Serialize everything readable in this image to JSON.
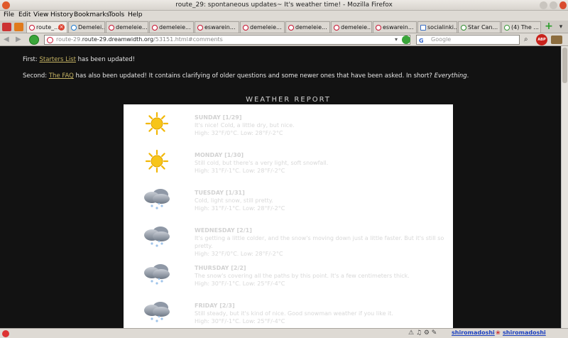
{
  "window": {
    "title": "route_29: spontaneous updates~ It's weather time! - Mozilla Firefox"
  },
  "menu": [
    "File",
    "Edit",
    "View",
    "History",
    "Bookmarks",
    "Tools",
    "Help"
  ],
  "tabs": [
    "route_...",
    "Demelei...",
    "demeleie...",
    "demeleie...",
    "eswarein...",
    "demeleie...",
    "demeleie...",
    "demeleie...",
    "eswarein...",
    "socialinki...",
    "Star Can...",
    "(4) The ..."
  ],
  "nav": {
    "url_host": "route-29.dreamwidth.org",
    "url_path": "/53151.html#comments",
    "search_placeholder": "Google"
  },
  "post": {
    "line1_prefix": "First: ",
    "line1_link": "Starters List",
    "line1_suffix": " has been updated!",
    "line2_prefix": "Second: ",
    "line2_link": "The FAQ",
    "line2_suffix": " has also been updated! It contains clarifying of older questions and some newer ones that have been asked. In short? ",
    "line2_em": "Everything",
    "line2_end": "."
  },
  "weather": {
    "heading": "WEATHER REPORT",
    "days": [
      {
        "name": "SUNDAY [1/29]",
        "desc": "It's nice! Cold, a little dry, but nice.",
        "temps": "High: 32°F/0°C. Low: 28°F/-2°C",
        "icon": "sun-icon"
      },
      {
        "name": "MONDAY [1/30]",
        "desc": "Still cold, but there's a very light, soft snowfall.",
        "temps": "High: 31°F/-1°C. Low: 28°F/-2°C",
        "icon": "sun-icon"
      },
      {
        "name": "TUESDAY [1/31]",
        "desc": "Cold, light snow, still pretty.",
        "temps": "High: 31°F/-1°C. Low: 28°F/-2°C",
        "icon": "snow-cloud-icon"
      },
      {
        "name": "WEDNESDAY [2/1]",
        "desc": "It's getting a little colder, and the snow's moving down just a little faster. But it's still so pretty.",
        "temps": "High: 32°F/0°C. Low: 28°F/-2°C",
        "icon": "snow-cloud-icon"
      },
      {
        "name": "THURSDAY [2/2]",
        "desc": "The snow's covering all the paths by this point. It's a few centimeters thick.",
        "temps": "High: 30°F/-1°C. Low: 25°F/-4°C",
        "icon": "snow-cloud-icon"
      },
      {
        "name": "FRIDAY [2/3]",
        "desc": "Still steady, but it's kind of nice. Good snowman weather if you like it.",
        "temps": "High: 30°F/-1°C. Low: 25°F/-4°C",
        "icon": "snow-cloud-icon"
      }
    ]
  },
  "status": {
    "user1": "shiromadoshi",
    "user2": "shiromadoshi"
  }
}
